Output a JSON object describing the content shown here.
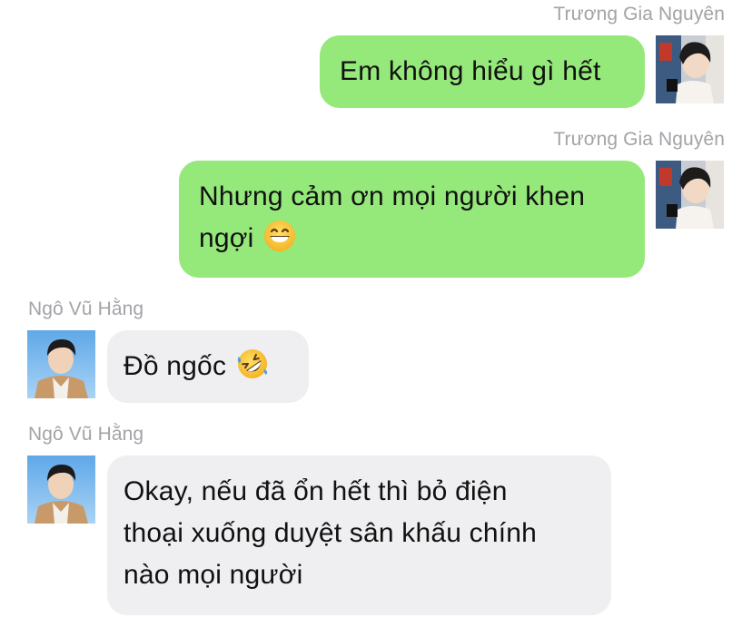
{
  "messages": [
    {
      "sender": "Trương Gia Nguyên",
      "direction": "outgoing",
      "text": "Em không hiểu gì hết",
      "emoji": ""
    },
    {
      "sender": "Trương Gia Nguyên",
      "direction": "outgoing",
      "text_line1": "Nhưng cảm ơn mọi người khen",
      "text_line2": "ngợi",
      "emoji": "grinning-face-icon"
    },
    {
      "sender": "Ngô Vũ Hằng",
      "direction": "incoming",
      "text": "Đồ ngốc",
      "emoji": "rolling-on-floor-laughing-icon"
    },
    {
      "sender": "Ngô Vũ Hằng",
      "direction": "incoming",
      "text_line1": "Okay, nếu đã ổn hết thì bỏ điện",
      "text_line2": "thoại xuống duyệt sân khấu chính",
      "text_line3": "nào mọi người",
      "emoji": ""
    }
  ],
  "colors": {
    "outgoing_bubble": "#95e87a",
    "incoming_bubble": "#efeff1",
    "sender_name": "#a3a3a8",
    "message_text": "#111111"
  }
}
